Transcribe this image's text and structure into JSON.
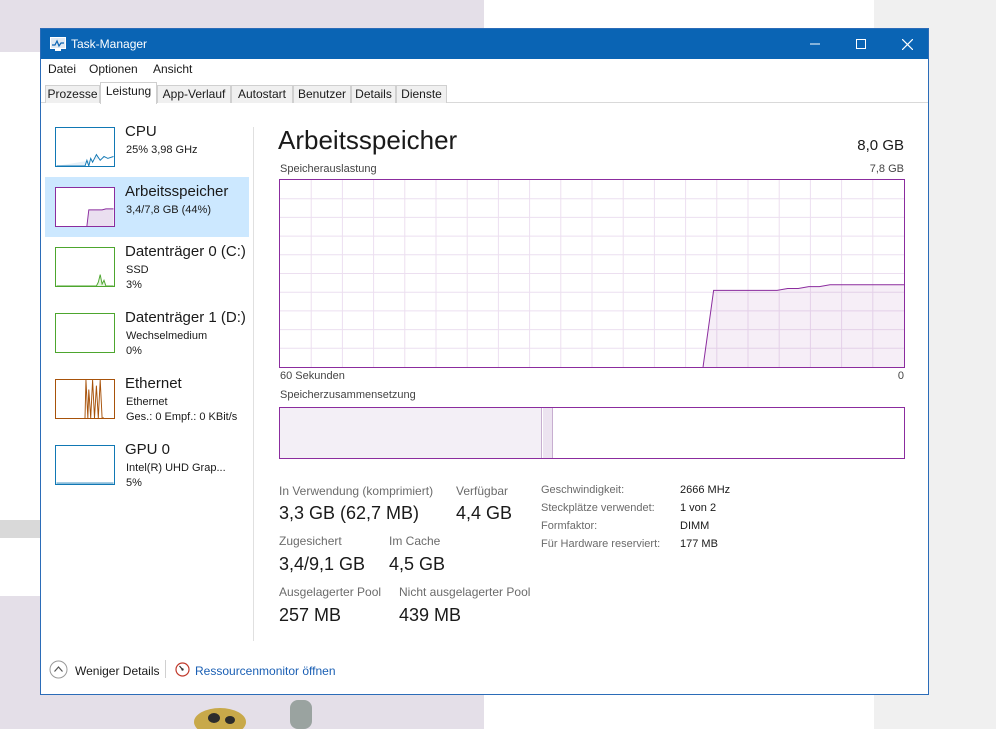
{
  "window": {
    "title": "Task-Manager"
  },
  "menu": [
    "Datei",
    "Optionen",
    "Ansicht"
  ],
  "tabs": [
    "Prozesse",
    "Leistung",
    "App-Verlauf",
    "Autostart",
    "Benutzer",
    "Details",
    "Dienste"
  ],
  "active_tab": "Leistung",
  "sidebar": {
    "items": [
      {
        "title": "CPU",
        "lines": [
          "25% 3,98 GHz"
        ],
        "color": "#1178b4"
      },
      {
        "title": "Arbeitsspeicher",
        "lines": [
          "3,4/7,8 GB (44%)"
        ],
        "color": "#8b2c9e",
        "selected": true
      },
      {
        "title": "Datenträger 0 (C:)",
        "lines": [
          "SSD",
          "3%"
        ],
        "color": "#4da62e"
      },
      {
        "title": "Datenträger 1 (D:)",
        "lines": [
          "Wechselmedium",
          "0%"
        ],
        "color": "#4da62e"
      },
      {
        "title": "Ethernet",
        "lines": [
          "Ethernet",
          "Ges.: 0 Empf.: 0 KBit/s"
        ],
        "color": "#a7520a"
      },
      {
        "title": "GPU 0",
        "lines": [
          "Intel(R) UHD Grap...",
          "5%"
        ],
        "color": "#1178b4"
      }
    ]
  },
  "main": {
    "title": "Arbeitsspeicher",
    "total": "8,0 GB",
    "graph_label": "Speicherauslastung",
    "graph_max": "7,8 GB",
    "graph_time": "60 Sekunden",
    "graph_min": "0",
    "composition_label": "Speicherzusammensetzung",
    "usage_fraction": [
      0,
      0,
      0,
      0,
      0,
      0,
      0,
      0,
      0,
      0,
      0,
      0,
      0,
      0,
      0,
      0,
      0,
      0,
      0,
      0,
      0,
      0,
      0,
      0,
      0,
      0,
      0,
      0,
      0,
      0,
      0,
      0,
      0,
      0,
      0,
      0,
      0,
      0,
      0,
      0,
      0,
      0.41,
      0.41,
      0.41,
      0.41,
      0.41,
      0.41,
      0.41,
      0.42,
      0.42,
      0.43,
      0.43,
      0.44,
      0.44,
      0.44,
      0.44,
      0.44,
      0.44,
      0.44,
      0.44
    ]
  },
  "stats": [
    {
      "label": "In Verwendung (komprimiert)",
      "value": "3,3 GB (62,7 MB)"
    },
    {
      "label": "Verfügbar",
      "value": "4,4 GB"
    },
    {
      "label": "Zugesichert",
      "value": "3,4/9,1 GB"
    },
    {
      "label": "Im Cache",
      "value": "4,5 GB"
    },
    {
      "label": "Ausgelagerter Pool",
      "value": "257 MB"
    },
    {
      "label": "Nicht ausgelagerter Pool",
      "value": "439 MB"
    }
  ],
  "details": [
    {
      "key": "Geschwindigkeit:",
      "value": "2666 MHz"
    },
    {
      "key": "Steckplätze verwendet:",
      "value": "1 von 2"
    },
    {
      "key": "Formfaktor:",
      "value": "DIMM"
    },
    {
      "key": "Für Hardware reserviert:",
      "value": "177 MB"
    }
  ],
  "footer": {
    "less_details": "Weniger Details",
    "resource_monitor": "Ressourcenmonitor öffnen"
  }
}
